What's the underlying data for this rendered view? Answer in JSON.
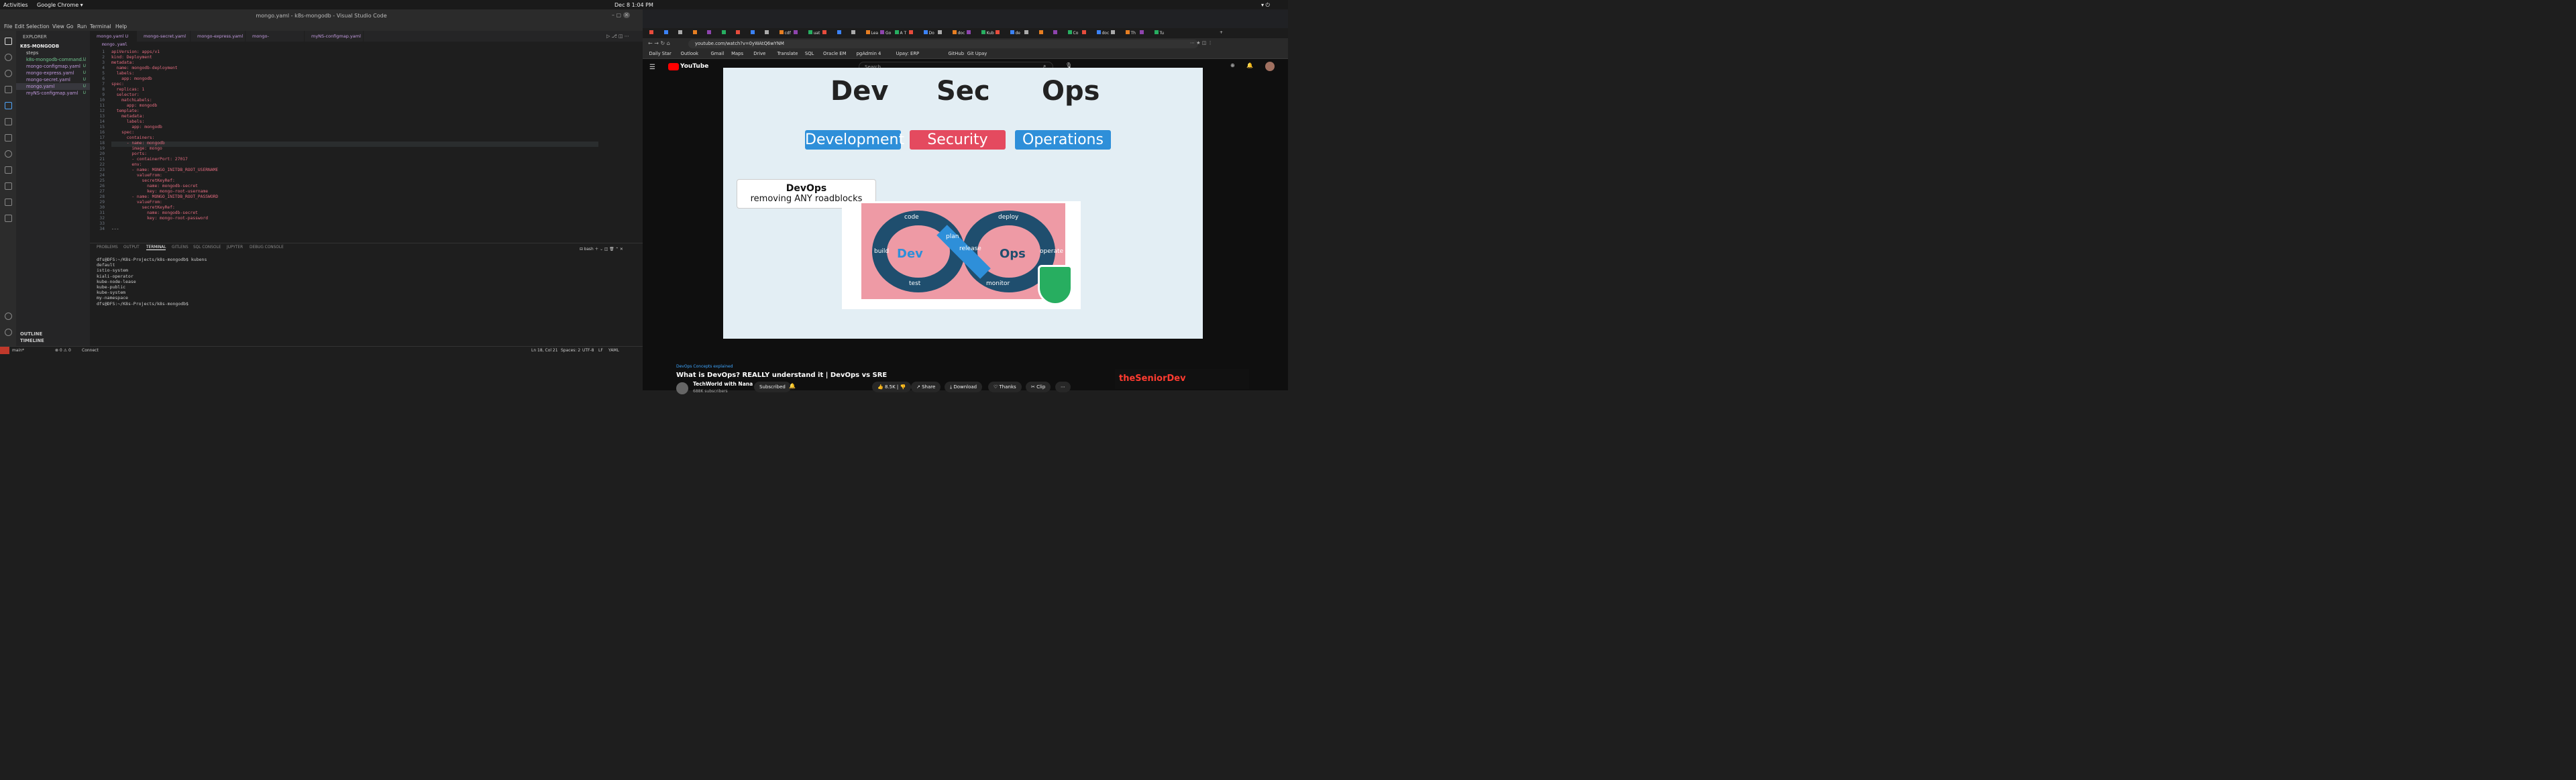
{
  "topbar": {
    "activities": "Activities",
    "app": "Google Chrome ▾",
    "clock": "Dec 8  1:04 PM"
  },
  "vscode": {
    "title": "mongo.yaml - k8s-mongodb - Visual Studio Code",
    "menu": [
      "File",
      "Edit",
      "Selection",
      "View",
      "Go",
      "Run",
      "Terminal",
      "Help"
    ],
    "explorer": {
      "header": "EXPLORER",
      "folder": "K8S-MONGODB",
      "items": [
        {
          "label": "steps",
          "badge": ""
        },
        {
          "label": "k8s-mongodb-command...",
          "badge": "U"
        },
        {
          "label": "mongo-configmap.yaml",
          "badge": "U"
        },
        {
          "label": "mongo-express.yaml",
          "badge": "U"
        },
        {
          "label": "mongo-secret.yaml",
          "badge": "U"
        },
        {
          "label": "mongo.yaml",
          "badge": "U"
        },
        {
          "label": "myNS-configmap.yaml",
          "badge": "U"
        }
      ],
      "outline": "OUTLINE",
      "timeline": "TIMELINE"
    },
    "tabs": [
      "mongo.yaml U",
      "mongo-secret.yaml U",
      "mongo-express.yaml U",
      "mongo-configmap.yaml U",
      "myNS-configmap.yaml U"
    ],
    "breadcrumb": "mongo.yaml",
    "code": [
      {
        "n": "1",
        "t": "apiVersion: apps/v1"
      },
      {
        "n": "2",
        "t": "kind: Deployment"
      },
      {
        "n": "3",
        "t": "metadata:"
      },
      {
        "n": "4",
        "t": "  name: mongodb-deployment"
      },
      {
        "n": "5",
        "t": "  labels:"
      },
      {
        "n": "6",
        "t": "    app: mongodb"
      },
      {
        "n": "7",
        "t": "spec:"
      },
      {
        "n": "8",
        "t": "  replicas: 1"
      },
      {
        "n": "9",
        "t": "  selector:"
      },
      {
        "n": "10",
        "t": "    matchLabels:"
      },
      {
        "n": "11",
        "t": "      app: mongodb"
      },
      {
        "n": "12",
        "t": "  template:"
      },
      {
        "n": "13",
        "t": "    metadata:"
      },
      {
        "n": "14",
        "t": "      labels:"
      },
      {
        "n": "15",
        "t": "        app: mongodb"
      },
      {
        "n": "16",
        "t": "    spec:"
      },
      {
        "n": "17",
        "t": "      containers:"
      },
      {
        "n": "18",
        "t": "      - name: mongodb"
      },
      {
        "n": "19",
        "t": "        image: mongo"
      },
      {
        "n": "20",
        "t": "        ports:"
      },
      {
        "n": "21",
        "t": "        - containerPort: 27017"
      },
      {
        "n": "22",
        "t": "        env:"
      },
      {
        "n": "23",
        "t": "        - name: MONGO_INITDB_ROOT_USERNAME"
      },
      {
        "n": "24",
        "t": "          valueFrom:"
      },
      {
        "n": "25",
        "t": "            secretKeyRef:"
      },
      {
        "n": "26",
        "t": "              name: mongodb-secret"
      },
      {
        "n": "27",
        "t": "              key: mongo-root-username"
      },
      {
        "n": "28",
        "t": "        - name: MONGO_INITDB_ROOT_PASSWORD"
      },
      {
        "n": "29",
        "t": "          valueFrom:"
      },
      {
        "n": "30",
        "t": "            secretKeyRef:"
      },
      {
        "n": "31",
        "t": "              name: mongodb-secret"
      },
      {
        "n": "32",
        "t": "              key: mongo-root-password"
      },
      {
        "n": "33",
        "t": ""
      },
      {
        "n": "34",
        "t": "---"
      }
    ],
    "panel_tabs": [
      "PROBLEMS",
      "OUTPUT",
      "TERMINAL",
      "GITLENS",
      "SQL CONSOLE",
      "JUPYTER",
      "DEBUG CONSOLE"
    ],
    "shell": "bash",
    "terminal": "dfs@DFS:~/K8s-Projects/k8s-mongodb$ kubens\ndefault\nistio-system\nkiali-operator\nkube-node-lease\nkube-public\nkube-system\nmy-namespace\ndfs@DFS:~/K8s-Projects/k8s-mongodb$ ",
    "status": {
      "branch": "main*",
      "errors": "⊗ 0 ⚠ 0",
      "connect": "Connect",
      "pos": "Ln 18, Col 21",
      "spaces": "Spaces: 2",
      "enc": "UTF-8",
      "eol": "LF",
      "lang": "YAML"
    }
  },
  "chrome": {
    "tabs": [
      "",
      "",
      "",
      "",
      "",
      "",
      "",
      "",
      "",
      "cdf",
      "",
      "uat",
      "",
      "",
      "",
      "Lea",
      "Go",
      "A T",
      "",
      "Do",
      "",
      "doc",
      "",
      "Kub",
      "",
      "de",
      "",
      "",
      "",
      "Co",
      "",
      "doc",
      "",
      "Th",
      "",
      "Tu"
    ],
    "url": "youtube.com/watch?v=0yWAtQ6wYNM",
    "bookmarks": [
      "Daily Star",
      "Outlook",
      "Gmail",
      "Maps",
      "Drive",
      "Translate",
      "SQL",
      "Oracle EM",
      "pgAdmin 4",
      "Upay: ERP",
      "GitHub",
      "Git Upay"
    ]
  },
  "youtube": {
    "logo": "YouTube",
    "search_placeholder": "Search",
    "slide": {
      "w1": "Dev",
      "w2": "Sec",
      "w3": "Ops",
      "p1": "Development",
      "p2": "Security",
      "p3": "Operations",
      "callout_title": "DevOps",
      "callout_sub": "removing ANY roadblocks",
      "loop": [
        "code",
        "plan",
        "build",
        "test",
        "release",
        "deploy",
        "operate",
        "monitor"
      ],
      "dev": "Dev",
      "ops": "Ops"
    },
    "hashtag": "DevOps Concepts explained",
    "video_title": "What is DevOps? REALLY understand it | DevOps vs SRE",
    "channel": "TechWorld with Nana",
    "subs": "688K subscribers",
    "subscribed": "Subscribed",
    "likes": "8.5K",
    "share": "Share",
    "download": "Download",
    "thanks": "Thanks",
    "clip": "Clip",
    "ad_text": "theSeniorDev"
  },
  "colors": {
    "dev_pill": "#2e8fd9",
    "sec_pill": "#e44a5f",
    "ops_pill": "#2e8fd9",
    "yt_red": "#ff0000"
  }
}
